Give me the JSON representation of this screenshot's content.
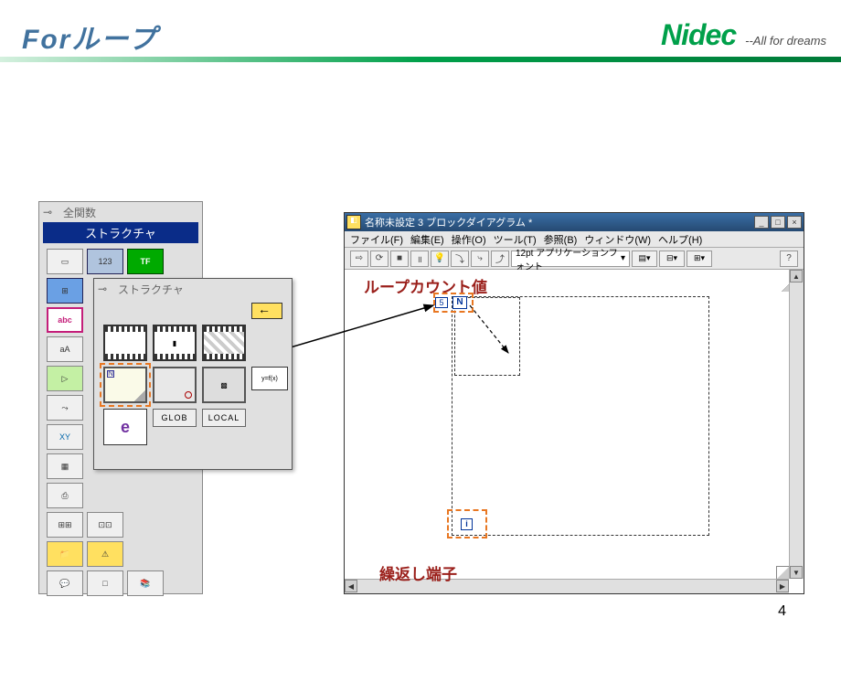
{
  "slide": {
    "title": "Forループ",
    "page_number": "4"
  },
  "brand": {
    "logo_text": "Nidec",
    "tagline": "--All for dreams"
  },
  "palette": {
    "header": "全関数",
    "label": "ストラクチャ"
  },
  "sub_palette": {
    "header": "ストラクチャ",
    "formula_label": "y=f(x)",
    "globals": "GLOB",
    "locals": "LOCAL",
    "e_label": "e"
  },
  "lv_window": {
    "title": "名称未設定 3 ブロックダイアグラム *",
    "menu": {
      "file": "ファイル(F)",
      "edit": "編集(E)",
      "operate": "操作(O)",
      "tool": "ツール(T)",
      "browse": "参照(B)",
      "window": "ウィンドウ(W)",
      "help": "ヘルプ(H)"
    },
    "toolbar": {
      "font_label": "12pt アプリケーションフォント"
    },
    "labels": {
      "loop_count": "ループカウント値",
      "repeat_terminal": "繰返し端子"
    },
    "terminals": {
      "n": "N",
      "i": "i",
      "constant": "5"
    }
  }
}
